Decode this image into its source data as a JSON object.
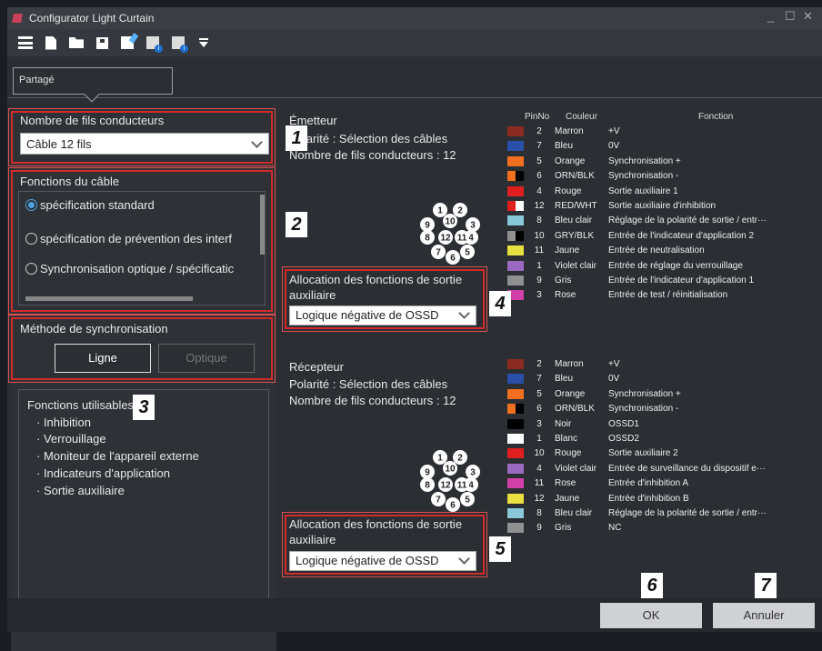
{
  "app": {
    "title": "Configurator Light Curtain"
  },
  "tab": {
    "label": "Partagé"
  },
  "wires": {
    "title": "Nombre de fils conducteurs",
    "selected": "Câble 12 fils"
  },
  "cable": {
    "title": "Fonctions du câble",
    "options": [
      "spécification standard",
      "spécification de prévention des interf",
      "Synchronisation optique / spécificatic"
    ],
    "selected_index": 0
  },
  "sync": {
    "title": "Méthode de synchronisation",
    "line_label": "Ligne",
    "optical_label": "Optique"
  },
  "usable": {
    "title": "Fonctions utilisables",
    "items": [
      "· Inhibition",
      "· Verrouillage",
      "· Moniteur de l'appareil externe",
      "· Indicateurs d'application",
      "· Sortie auxiliaire"
    ]
  },
  "emitter": {
    "title": "Émetteur",
    "polarity": "Polarité : Sélection des câbles",
    "wire_count": "Nombre de fils conducteurs : 12",
    "alloc_label": "Allocation des fonctions de sortie auxiliaire",
    "alloc_value": "Logique négative de OSSD"
  },
  "receiver": {
    "title": "Récepteur",
    "polarity": "Polarité : Sélection des câbles",
    "wire_count": "Nombre de fils conducteurs : 12",
    "alloc_label": "Allocation des fonctions de sortie auxiliaire",
    "alloc_value": "Logique négative de OSSD"
  },
  "pin_headers": {
    "pin": "PinNo",
    "color": "Couleur",
    "function": "Fonction"
  },
  "emitter_pins": [
    {
      "pin": "2",
      "color": "Marron",
      "function": "+V",
      "swatch": "#8b2a22"
    },
    {
      "pin": "7",
      "color": "Bleu",
      "function": "0V",
      "swatch": "#2a4fa8"
    },
    {
      "pin": "5",
      "color": "Orange",
      "function": "Synchronisation +",
      "swatch": "#f07020"
    },
    {
      "pin": "6",
      "color": "ORN/BLK",
      "function": "Synchronisation -",
      "swatch": "split-orange"
    },
    {
      "pin": "4",
      "color": "Rouge",
      "function": "Sortie auxiliaire 1",
      "swatch": "#e02020"
    },
    {
      "pin": "12",
      "color": "RED/WHT",
      "function": "Sortie auxiliaire d'inhibition",
      "swatch": "split-red"
    },
    {
      "pin": "8",
      "color": "Bleu clair",
      "function": "Réglage de la polarité de sortie / entr···",
      "swatch": "#88c8d8"
    },
    {
      "pin": "10",
      "color": "GRY/BLK",
      "function": "Entrée de l'indicateur d'application 2",
      "swatch": "split-gray"
    },
    {
      "pin": "11",
      "color": "Jaune",
      "function": "Entrée de neutralisation",
      "swatch": "#e8e040"
    },
    {
      "pin": "1",
      "color": "Violet clair",
      "function": "Entrée de réglage du verrouillage",
      "swatch": "#9a6ac0"
    },
    {
      "pin": "9",
      "color": "Gris",
      "function": "Entrée de l'indicateur d'application 1",
      "swatch": "#909090"
    },
    {
      "pin": "3",
      "color": "Rose",
      "function": "Entrée de test / réinitialisation",
      "swatch": "#d040a8"
    }
  ],
  "receiver_pins": [
    {
      "pin": "2",
      "color": "Marron",
      "function": "+V",
      "swatch": "#8b2a22"
    },
    {
      "pin": "7",
      "color": "Bleu",
      "function": "0V",
      "swatch": "#2a4fa8"
    },
    {
      "pin": "5",
      "color": "Orange",
      "function": "Synchronisation +",
      "swatch": "#f07020"
    },
    {
      "pin": "6",
      "color": "ORN/BLK",
      "function": "Synchronisation -",
      "swatch": "split-orange"
    },
    {
      "pin": "3",
      "color": "Noir",
      "function": "OSSD1",
      "swatch": "#000000"
    },
    {
      "pin": "1",
      "color": "Blanc",
      "function": "OSSD2",
      "swatch": "#ffffff"
    },
    {
      "pin": "10",
      "color": "Rouge",
      "function": "Sortie auxiliaire 2",
      "swatch": "#e02020"
    },
    {
      "pin": "4",
      "color": "Violet clair",
      "function": "Entrée de surveillance du dispositif e···",
      "swatch": "#9a6ac0"
    },
    {
      "pin": "11",
      "color": "Rose",
      "function": "Entrée d'inhibition A",
      "swatch": "#d040a8"
    },
    {
      "pin": "12",
      "color": "Jaune",
      "function": "Entrée d'inhibition B",
      "swatch": "#e8e040"
    },
    {
      "pin": "8",
      "color": "Bleu clair",
      "function": "Réglage de la polarité de sortie / entr···",
      "swatch": "#88c8d8"
    },
    {
      "pin": "9",
      "color": "Gris",
      "function": "NC",
      "swatch": "#909090"
    }
  ],
  "connector_pins": [
    "1",
    "2",
    "3",
    "4",
    "5",
    "6",
    "7",
    "8",
    "9",
    "10",
    "11",
    "12"
  ],
  "callouts": [
    "1",
    "2",
    "3",
    "4",
    "5",
    "6",
    "7"
  ],
  "buttons": {
    "ok": "OK",
    "cancel": "Annuler"
  },
  "colors": {
    "highlight": "#d32a2a",
    "accent": "#4aa3df"
  }
}
